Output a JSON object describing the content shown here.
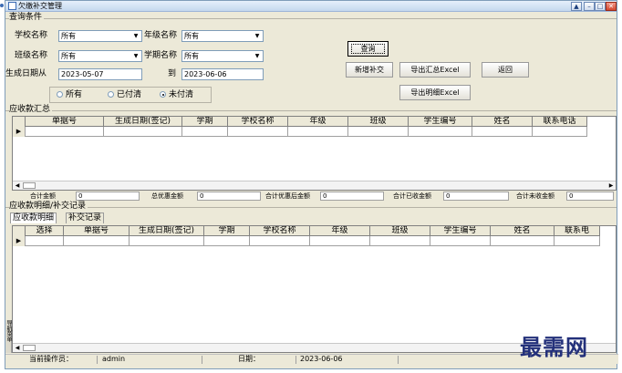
{
  "window": {
    "title": "欠缴补交管理",
    "buttons": {
      "minimize": "▲",
      "restore": "–",
      "maximize": "□",
      "close": "✕"
    }
  },
  "query": {
    "section_title": "查询条件",
    "school_label": "学校名称",
    "school_value": "所有",
    "grade_label": "年级名称",
    "grade_value": "所有",
    "class_label": "班级名称",
    "class_value": "所有",
    "term_label": "学期名称",
    "term_value": "所有",
    "date_from_label": "生成日期从",
    "date_from_value": "2023-05-07",
    "date_to_label": "到",
    "date_to_value": "2023-06-06",
    "radios": [
      {
        "label": "所有",
        "checked": false
      },
      {
        "label": "已付清",
        "checked": false
      },
      {
        "label": "未付清",
        "checked": true
      }
    ],
    "buttons": {
      "query": "查询",
      "add_makeup": "新增补交",
      "export_summary": "导出汇总Excel",
      "back": "返回",
      "export_detail": "导出明细Excel"
    }
  },
  "summary": {
    "section_title": "应收款汇总",
    "columns": [
      "单据号",
      "生成日期(签记)",
      "学期",
      "学校名称",
      "年级",
      "班级",
      "学生编号",
      "姓名",
      "联系电话"
    ],
    "totals": [
      {
        "label": "合计金额",
        "value": "0"
      },
      {
        "label": "总优惠金额",
        "value": "0"
      },
      {
        "label": "合计优惠后金额",
        "value": "0"
      },
      {
        "label": "合计已收金额",
        "value": "0"
      },
      {
        "label": "合计未收金额",
        "value": "0"
      }
    ]
  },
  "detail": {
    "section_title": "应收款明细/补交记录",
    "tabs": [
      "应收款明细",
      "补交记录"
    ],
    "columns": [
      "选择",
      "单据号",
      "生成日期(签记)",
      "学期",
      "学校名称",
      "年级",
      "班级",
      "学生编号",
      "姓名",
      "联系电"
    ]
  },
  "side_label": "导航菜单",
  "status": {
    "operator_label": "当前操作员：",
    "operator_value": "admin",
    "date_label": "日期：",
    "date_value": "2023-06-06"
  },
  "watermark": "最需网"
}
